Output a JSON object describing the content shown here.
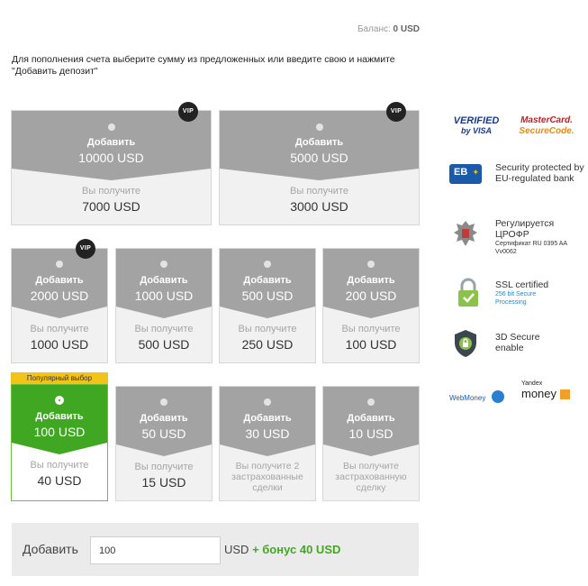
{
  "balance": {
    "label": "Баланс:",
    "value": "0 USD"
  },
  "intro": "Для пополнения счета выберите сумму из предложенных или введите свою и нажмите \"Добавить депозит\"",
  "cards": [
    {
      "add_label": "Добавить",
      "add_amount": "10000 USD",
      "get_label": "Вы получите",
      "get_amount": "7000 USD",
      "vip": "VIP"
    },
    {
      "add_label": "Добавить",
      "add_amount": "5000 USD",
      "get_label": "Вы получите",
      "get_amount": "3000 USD",
      "vip": "VIP"
    },
    {
      "add_label": "Добавить",
      "add_amount": "2000 USD",
      "get_label": "Вы получите",
      "get_amount": "1000 USD",
      "vip": "VIP"
    },
    {
      "add_label": "Добавить",
      "add_amount": "1000 USD",
      "get_label": "Вы получите",
      "get_amount": "500 USD"
    },
    {
      "add_label": "Добавить",
      "add_amount": "500 USD",
      "get_label": "Вы получите",
      "get_amount": "250 USD"
    },
    {
      "add_label": "Добавить",
      "add_amount": "200 USD",
      "get_label": "Вы получите",
      "get_amount": "100 USD"
    },
    {
      "add_label": "Добавить",
      "add_amount": "100 USD",
      "get_label": "Вы получите",
      "get_amount": "40 USD",
      "badge": "Популярный выбор",
      "selected": true
    },
    {
      "add_label": "Добавить",
      "add_amount": "50 USD",
      "get_label": "Вы получите",
      "get_amount": "15 USD"
    },
    {
      "add_label": "Добавить",
      "add_amount": "30 USD",
      "get_text": "Вы получите 2 застрахованные сделки"
    },
    {
      "add_label": "Добавить",
      "add_amount": "10 USD",
      "get_text": "Вы получите застрахованную сделку"
    }
  ],
  "deposit": {
    "label": "Добавить",
    "value": "100",
    "currency": "USD",
    "bonus": "+ бонус 40 USD"
  },
  "side": {
    "verified_line1": "VERIFIED",
    "verified_line2": "by VISA",
    "mc_line1": "MasterCard.",
    "mc_line2": "SecureCode.",
    "eb_logo": "EB",
    "eb_text": "Security protected by EU-regulated bank",
    "crofr_text": "Регулируется ЦРОФР",
    "crofr_small": "Сертификат RU 0395 AA Vv0062",
    "ssl_text": "SSL certified",
    "ssl_small": "256 bit Secure Processing",
    "secure3d_text": "3D Secure enable",
    "webmoney": "WebMoney",
    "yandex_line1": "Yandex",
    "yandex_line2": "money"
  },
  "colors": {
    "card_gray": "#a3a3a3",
    "card_green": "#3fa722",
    "bonus_green": "#3faa1e",
    "badge_yellow": "#f2c318"
  }
}
